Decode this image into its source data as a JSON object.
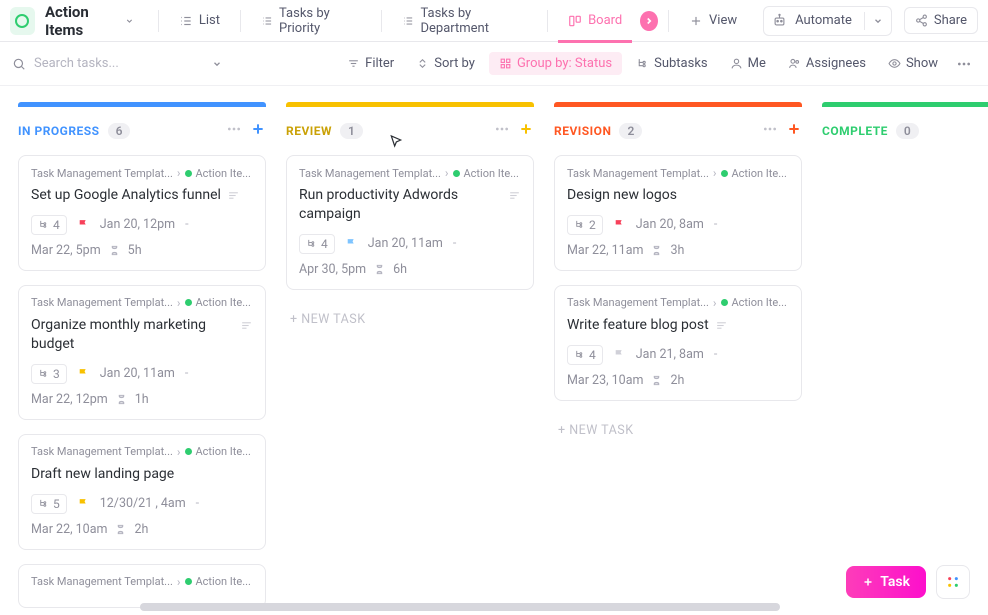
{
  "header": {
    "title": "Action Items",
    "views": {
      "list": "List",
      "priority": "Tasks by Priority",
      "department": "Tasks by Department",
      "board": "Board",
      "add_view": "View"
    },
    "automate": "Automate",
    "share": "Share"
  },
  "toolbar": {
    "search_placeholder": "Search tasks...",
    "filter": "Filter",
    "sort": "Sort by",
    "group": "Group by: Status",
    "subtasks": "Subtasks",
    "me": "Me",
    "assignees": "Assignees",
    "show": "Show"
  },
  "board": {
    "new_task_label": "+ NEW TASK",
    "columns": [
      {
        "id": "in_progress",
        "title": "IN PROGRESS",
        "count": "6",
        "color_bar": "#4193ff",
        "title_color": "#4193ff",
        "plus_color": "#4193ff",
        "cards": [
          {
            "crumb1": "Task Management Templat...",
            "crumb2": "Action Ite...",
            "title": "Set up Google Analytics funnel",
            "has_desc": true,
            "sub": "4",
            "flag": "red",
            "date": "Jan 20, 12pm",
            "dash": "-",
            "bottom_date": "Mar 22, 5pm",
            "est": "5h"
          },
          {
            "crumb1": "Task Management Templat...",
            "crumb2": "Action Ite...",
            "title": "Organize monthly marketing budget",
            "has_desc": true,
            "sub": "3",
            "flag": "yellow",
            "date": "Jan 20, 11am",
            "dash": "-",
            "bottom_date": "Mar 22, 12pm",
            "est": "1h"
          },
          {
            "crumb1": "Task Management Templat...",
            "crumb2": "Action Ite...",
            "title": "Draft new landing page",
            "has_desc": false,
            "sub": "5",
            "flag": "yellow",
            "date": "12/30/21 , 4am",
            "dash": "-",
            "bottom_date": "Mar 22, 10am",
            "est": "2h"
          },
          {
            "crumb1": "Task Management Templat...",
            "crumb2": "Action Ite...",
            "title": "",
            "has_desc": false,
            "sub": "",
            "flag": "",
            "date": "",
            "dash": "",
            "bottom_date": "",
            "est": ""
          }
        ]
      },
      {
        "id": "review",
        "title": "REVIEW",
        "count": "1",
        "color_bar": "#f8c100",
        "title_color": "#caa106",
        "plus_color": "#f8c100",
        "cards": [
          {
            "crumb1": "Task Management Templat...",
            "crumb2": "Action Ite...",
            "title": "Run productivity Adwords campaign",
            "has_desc": true,
            "sub": "4",
            "flag": "blue",
            "date": "Jan 20, 11am",
            "dash": "-",
            "bottom_date": "Apr 30, 5pm",
            "est": "6h"
          }
        ]
      },
      {
        "id": "revision",
        "title": "REVISION",
        "count": "2",
        "color_bar": "#ff5722",
        "title_color": "#ff5722",
        "plus_color": "#ff5722",
        "cards": [
          {
            "crumb1": "Task Management Templat...",
            "crumb2": "Action Ite...",
            "title": "Design new logos",
            "has_desc": false,
            "sub": "2",
            "flag": "red",
            "date": "Jan 20, 8am",
            "dash": "-",
            "bottom_date": "Mar 22, 11am",
            "est": "3h"
          },
          {
            "crumb1": "Task Management Templat...",
            "crumb2": "Action Ite...",
            "title": "Write feature blog post",
            "has_desc": true,
            "sub": "4",
            "flag": "grey",
            "date": "Jan 21, 8am",
            "dash": "-",
            "bottom_date": "Mar 23, 10am",
            "est": "2h"
          }
        ]
      },
      {
        "id": "complete",
        "title": "COMPLETE",
        "count": "0",
        "color_bar": "#2ecd6f",
        "title_color": "#2ecd6f",
        "plus_color": "#2ecd6f",
        "cards": []
      }
    ]
  },
  "fab": {
    "task": "Task"
  }
}
